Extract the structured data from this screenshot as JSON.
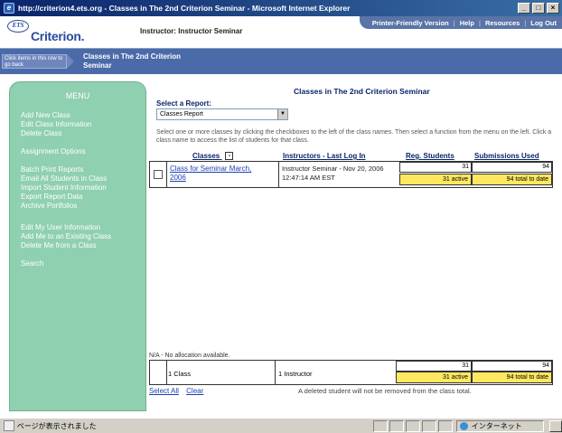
{
  "window": {
    "title": "http://criterion4.ets.org - Classes in The 2nd Criterion Seminar - Microsoft Internet Explorer",
    "min": "_",
    "max": "□",
    "close": "×"
  },
  "header": {
    "logo_ets": "ETS",
    "logo_text": "Criterion.",
    "instructor": "Instructor: Instructor Seminar",
    "nav": [
      "Printer-Friendly Version",
      "Help",
      "Resources",
      "Log Out"
    ]
  },
  "breadcrumb": {
    "hint": "Click items in this row to go back",
    "title": "Classes in The 2nd Criterion Seminar"
  },
  "menu": {
    "title": "MENU",
    "groups": [
      [
        "Add New Class",
        "Edit Class Information",
        "Delete Class"
      ],
      [
        "Assignment Options"
      ],
      [
        "Batch Print Reports",
        "Email All Students in Class",
        "Import Student Information",
        "Export Report Data",
        "Archive Portfolios"
      ],
      [
        "Edit My User Information",
        "Add Me to an Existing Class",
        "Delete Me from a Class"
      ],
      [
        "Search"
      ]
    ]
  },
  "main": {
    "heading": "Classes in The 2nd Criterion Seminar",
    "report_label": "Select a Report:",
    "report_value": "Classes Report",
    "instructions": "Select one or more classes by clicking the checkboxes to the left of the class names. Then select a function from the menu on the left. Click a class name to access the list of students for that class.",
    "columns": {
      "classes": "Classes",
      "sort": "-",
      "instructors": "Instructors - Last Log In",
      "students": "Reg. Students",
      "submissions": "Submissions Used"
    },
    "row": {
      "class_name": "Class for Seminar March, 2006",
      "instructor": "Instructor Seminar - Nov 20, 2006 12:47:14 AM EST",
      "students": "31",
      "students_active": "31 active",
      "submissions": "94",
      "submissions_total": "94 total to date"
    },
    "na_note": "N/A - No allocation available.",
    "totals": {
      "classes": "1 Class",
      "instructors": "1 Instructor",
      "students": "31",
      "students_active": "31 active",
      "submissions": "94",
      "submissions_total": "94 total to date"
    },
    "select_all": "Select All",
    "clear": "Clear",
    "deleted_note": "A deleted student will not be removed from the class total."
  },
  "status": {
    "text": "ページが表示されました",
    "zone": "インターネット"
  }
}
